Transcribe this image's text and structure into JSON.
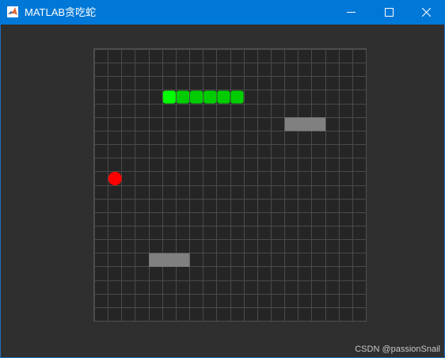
{
  "window": {
    "title": "MATLAB贪吃蛇",
    "icon": "matlab-logo-icon",
    "controls": [
      "minimize-icon",
      "maximize-icon",
      "close-icon"
    ]
  },
  "game": {
    "grid": {
      "cols": 20,
      "rows": 20
    },
    "snake": {
      "head": [
        5,
        3
      ],
      "body": [
        [
          6,
          3
        ],
        [
          7,
          3
        ],
        [
          8,
          3
        ],
        [
          9,
          3
        ],
        [
          10,
          3
        ]
      ],
      "head_color": "#00ff00",
      "body_color": "#00cc00"
    },
    "food": {
      "cell": [
        1,
        9
      ],
      "color": "#ff0000"
    },
    "obstacles": [
      {
        "cells": [
          [
            14,
            5
          ],
          [
            15,
            5
          ],
          [
            16,
            5
          ]
        ],
        "color": "#808080"
      },
      {
        "cells": [
          [
            4,
            15
          ],
          [
            5,
            15
          ],
          [
            6,
            15
          ]
        ],
        "color": "#808080"
      }
    ],
    "colors": {
      "background": "#252525",
      "grid_line": "#4a4a4a",
      "figure": "#2f2f2f"
    }
  },
  "watermark": "CSDN @passionSnail"
}
